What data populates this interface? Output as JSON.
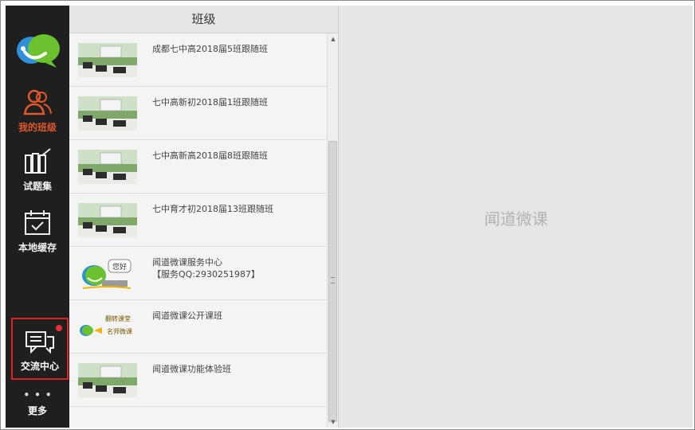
{
  "sidebar": {
    "nav": [
      {
        "label": "我的班级",
        "icon": "users-icon",
        "active": true
      },
      {
        "label": "试题集",
        "icon": "books-icon",
        "active": false
      },
      {
        "label": "本地缓存",
        "icon": "calendar-check-icon",
        "active": false
      }
    ],
    "message_center": {
      "label": "交流中心",
      "icon": "chat-icon",
      "badge": true
    },
    "more": {
      "dots": "•••",
      "label": "更多"
    }
  },
  "list": {
    "header": "班级",
    "items": [
      {
        "title": "",
        "sub": "",
        "thumb": "classroom"
      },
      {
        "title": "成都七中高2018届5班跟随班",
        "sub": "",
        "thumb": "classroom"
      },
      {
        "title": "七中高新初2018届1班跟随班",
        "sub": "",
        "thumb": "classroom"
      },
      {
        "title": "七中高新高2018届8班跟随班",
        "sub": "",
        "thumb": "classroom"
      },
      {
        "title": "七中育才初2018届13班跟随班",
        "sub": "",
        "thumb": "classroom"
      },
      {
        "title": "闻道微课服务中心",
        "sub": "【服务QQ:2930251987】",
        "thumb": "service",
        "thumb_text": "您好"
      },
      {
        "title": "闻道微课公开课班",
        "sub": "",
        "thumb": "open-class",
        "thumb_text": [
          "翻转课堂",
          "名师微课"
        ]
      },
      {
        "title": "闻道微课功能体验班",
        "sub": "",
        "thumb": "classroom"
      }
    ]
  },
  "main": {
    "placeholder": "闻道微课"
  },
  "colors": {
    "sidebar_bg": "#1f1f1f",
    "active_label": "#e0582c",
    "highlight_border": "#d8232a",
    "badge": "#e8303a"
  }
}
